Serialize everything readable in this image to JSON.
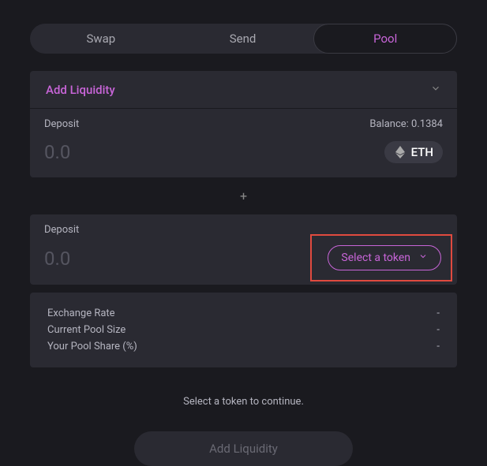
{
  "tabs": {
    "swap": "Swap",
    "send": "Send",
    "pool": "Pool"
  },
  "panel": {
    "title": "Add Liquidity"
  },
  "deposit1": {
    "label": "Deposit",
    "balance_label": "Balance: 0.1384",
    "amount": "0.0",
    "token_symbol": "ETH"
  },
  "plus": "+",
  "deposit2": {
    "label": "Deposit",
    "amount": "0.0",
    "select_label": "Select a token"
  },
  "stats": {
    "exchange_rate_label": "Exchange Rate",
    "exchange_rate_value": "-",
    "pool_size_label": "Current Pool Size",
    "pool_size_value": "-",
    "pool_share_label": "Your Pool Share (%)",
    "pool_share_value": "-"
  },
  "helper": "Select a token to continue.",
  "add_button": "Add Liquidity"
}
